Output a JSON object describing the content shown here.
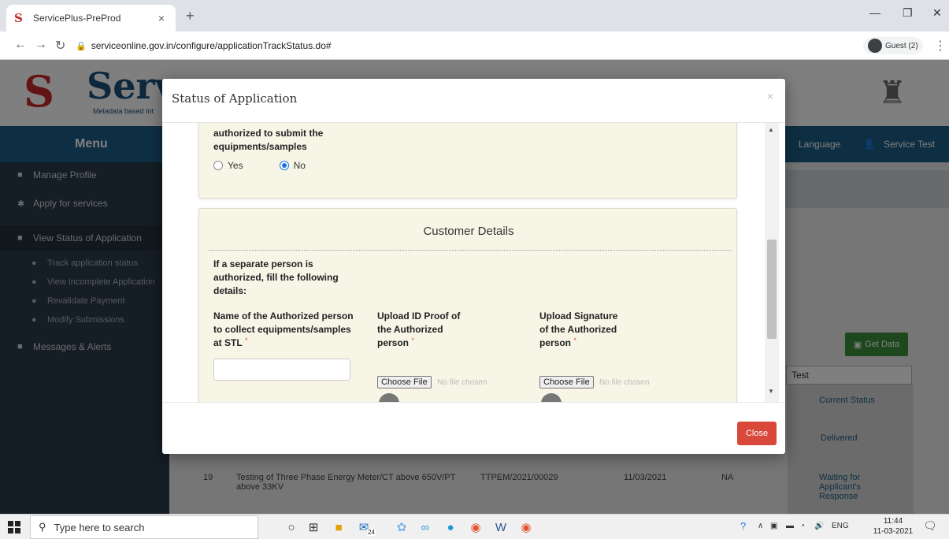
{
  "browser": {
    "tab_title": "ServicePlus-PreProd",
    "tab_close": "×",
    "new_tab": "+",
    "url": "serviceonline.gov.in/configure/applicationTrackStatus.do#",
    "guest_label": "Guest (2)"
  },
  "page": {
    "logo_text": "Serv",
    "logo_sub": "Metadata based Int",
    "menu_label": "Menu",
    "language": "Language",
    "user": "Service Test",
    "sidebar": [
      {
        "label": "Manage Profile"
      },
      {
        "label": "Apply for services"
      },
      {
        "label": "View Status of Application"
      },
      {
        "label": "Track application status"
      },
      {
        "label": "View Incomplete Application"
      },
      {
        "label": "Revalidate Payment"
      },
      {
        "label": "Modify Submissions"
      },
      {
        "label": "Messages & Alerts"
      }
    ],
    "get_data": "Get Data",
    "test_value": "Test",
    "current_status": "Current Status",
    "status_delivered": "Delivered",
    "row19": {
      "sno": "19",
      "service": "Testing of Three Phase Energy Meter/CT above 650V/PT above 33KV",
      "app_no": "TTPEM/2021/00029",
      "date": "11/03/2021",
      "na": "NA",
      "status": "Waiting for Applicant's Response"
    }
  },
  "modal": {
    "title": "Status of Application",
    "close_x": "×",
    "card1_label": "authorized to submit the equipments/samples",
    "radio_yes": "Yes",
    "radio_no": "No",
    "radio_selected": "No",
    "section_title": "Customer Details",
    "intro": "If a separate person is authorized, fill the following details:",
    "field_name_label": "Name of the Authorized person to collect equipments/samples at STL",
    "field_id_label": "Upload ID Proof of the Authorized person",
    "field_sig_label": "Upload Signature of the Authorized person",
    "required_mark": "*",
    "choose_file": "Choose File",
    "no_file": "No file chosen",
    "close_button": "Close"
  },
  "taskbar": {
    "search_placeholder": "Type here to search",
    "mail_badge": "24",
    "lang": "ENG",
    "time": "11:44",
    "date": "11-03-2021"
  }
}
